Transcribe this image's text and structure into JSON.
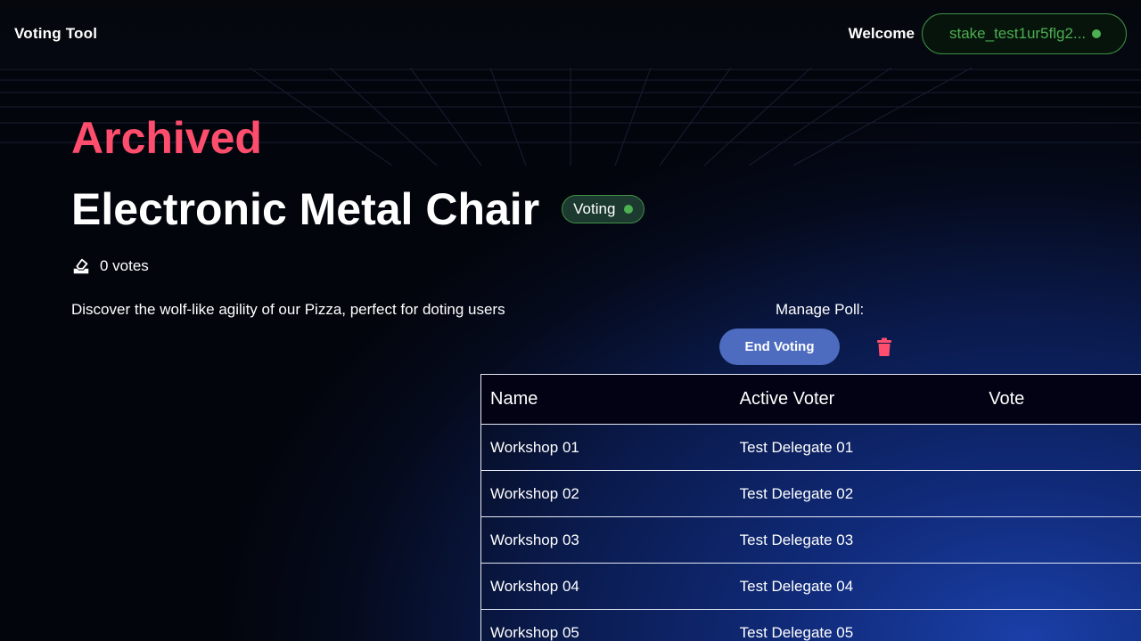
{
  "app": {
    "title": "Voting Tool"
  },
  "header": {
    "welcome": "Welcome",
    "wallet": "stake_test1ur5flg2..."
  },
  "poll": {
    "archived_label": "Archived",
    "title": "Electronic Metal Chair",
    "status": "Voting",
    "votes": "0 votes",
    "description": "Discover the wolf-like agility of our Pizza, perfect for doting users"
  },
  "manage": {
    "label": "Manage Poll:",
    "end_voting": "End Voting"
  },
  "table": {
    "headers": [
      "Name",
      "Active Voter",
      "Vote"
    ],
    "rows": [
      {
        "name": "Workshop 01",
        "voter": "Test Delegate 01",
        "vote": ""
      },
      {
        "name": "Workshop 02",
        "voter": "Test Delegate 02",
        "vote": ""
      },
      {
        "name": "Workshop 03",
        "voter": "Test Delegate 03",
        "vote": ""
      },
      {
        "name": "Workshop 04",
        "voter": "Test Delegate 04",
        "vote": ""
      },
      {
        "name": "Workshop 05",
        "voter": "Test Delegate 05",
        "vote": ""
      }
    ]
  },
  "colors": {
    "accent_red": "#ff4d6d",
    "status_green": "#4caf50",
    "button_blue": "#4d6cc0"
  },
  "icons": {
    "votes": "ballot-box-icon",
    "delete": "trash-icon",
    "status": "status-dot-icon"
  }
}
